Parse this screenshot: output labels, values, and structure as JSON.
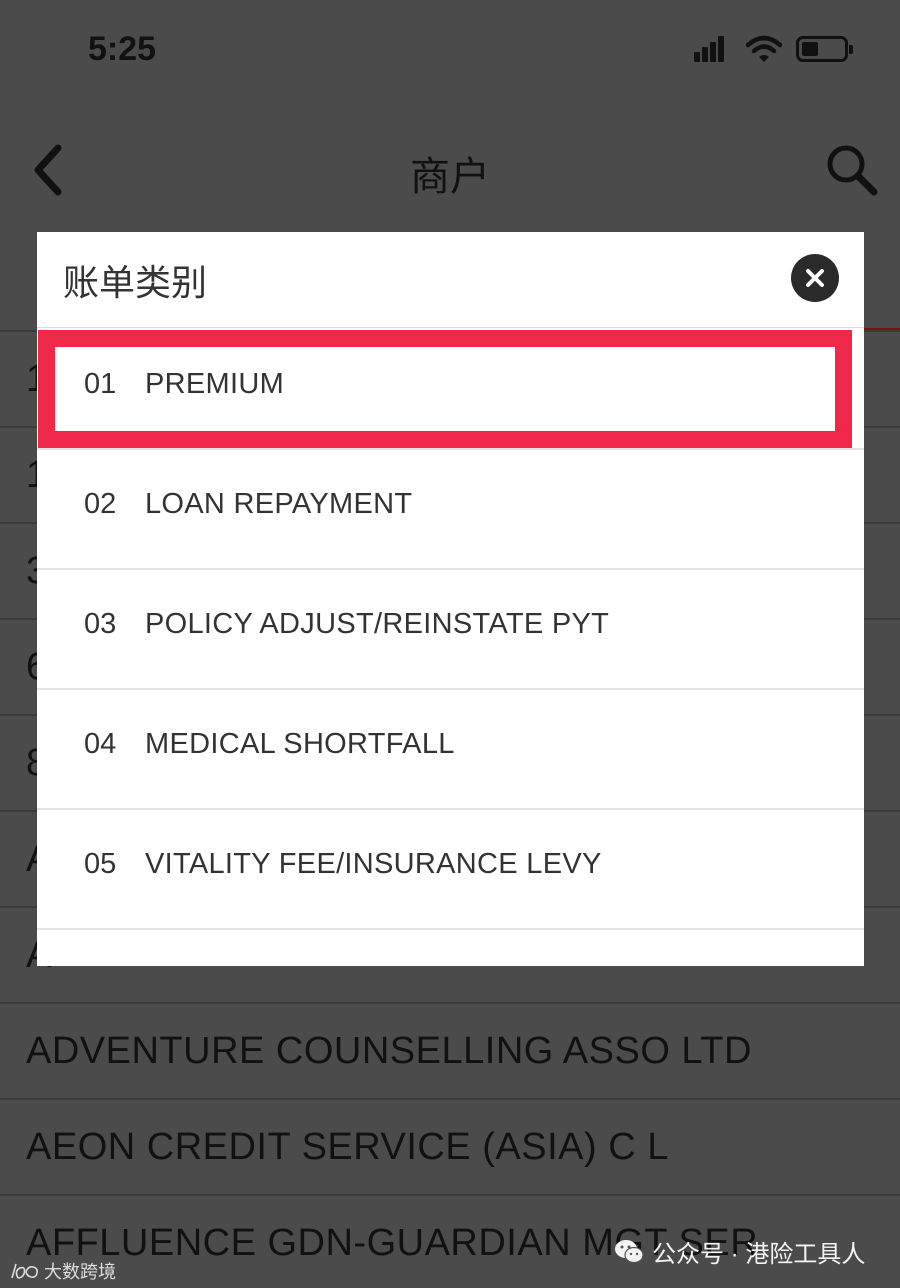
{
  "status_bar": {
    "time": "5:25"
  },
  "nav": {
    "title": "商户"
  },
  "background_list": {
    "partial_rows": [
      "1",
      "1",
      "3",
      "6",
      "8",
      "A",
      "A"
    ],
    "rows": [
      "ADVENTURE COUNSELLING ASSO LTD",
      "AEON CREDIT SERVICE (ASIA) C L",
      "AFFLUENCE GDN-GUARDIAN MGT SER"
    ]
  },
  "modal": {
    "title": "账单类别",
    "options": [
      {
        "code": "01",
        "label": "PREMIUM"
      },
      {
        "code": "02",
        "label": "LOAN REPAYMENT"
      },
      {
        "code": "03",
        "label": "POLICY ADJUST/REINSTATE PYT"
      },
      {
        "code": "04",
        "label": "MEDICAL SHORTFALL"
      },
      {
        "code": "05",
        "label": "VITALITY FEE/INSURANCE LEVY"
      }
    ]
  },
  "watermarks": {
    "left": "大数跨境",
    "right": "公众号 · 港险工具人"
  },
  "colors": {
    "highlight": "#f0284a",
    "overlay": "#4b4b4b",
    "modal_bg": "#ffffff"
  }
}
